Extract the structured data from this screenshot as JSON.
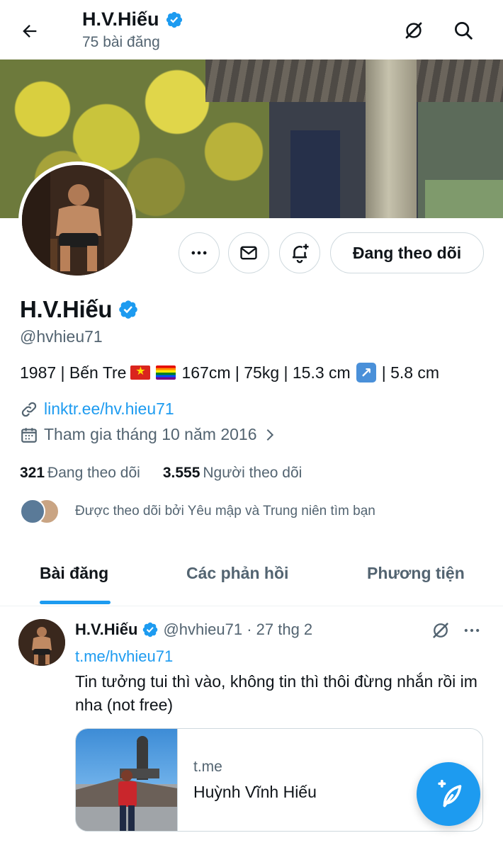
{
  "header": {
    "name": "H.V.Hiếu",
    "post_count": "75 bài đăng"
  },
  "profile": {
    "name": "H.V.Hiếu",
    "handle": "@hvhieu71",
    "bio": {
      "part1": "1987 | Bến Tre",
      "part2": "167cm | 75kg | 15.3 cm",
      "part3": "| 5.8 cm"
    },
    "link": "linktr.ee/hv.hieu71",
    "joined": "Tham gia tháng 10 năm 2016",
    "following_count": "321",
    "following_label": "Đang theo dõi",
    "followers_count": "3.555",
    "followers_label": "Người theo dõi",
    "followed_by": "Được theo dõi bởi Yêu mập và Trung niên tìm bạn",
    "follow_button": "Đang theo dõi"
  },
  "tabs": [
    {
      "label": "Bài đăng",
      "active": true
    },
    {
      "label": "Các phản hồi",
      "active": false
    },
    {
      "label": "Phương tiện",
      "active": false
    }
  ],
  "post": {
    "name": "H.V.Hiếu",
    "handle_date": "@hvhieu71 · 27 thg 2",
    "link": "t.me/hvhieu71",
    "text": "Tin tưởng tui thì vào, không tin thì thôi đừng nhắn rồi im nha (not free)",
    "card": {
      "domain": "t.me",
      "title": "Huỳnh Vĩnh Hiếu"
    }
  },
  "colors": {
    "accent": "#1d9bf0",
    "secondary_text": "#536471",
    "border": "#cfd9de"
  },
  "icons": [
    "back-arrow-icon",
    "verified-badge-icon",
    "grok-icon",
    "search-icon",
    "more-icon",
    "mail-icon",
    "notification-add-icon",
    "link-icon",
    "calendar-icon",
    "chevron-right-icon",
    "compose-icon"
  ]
}
